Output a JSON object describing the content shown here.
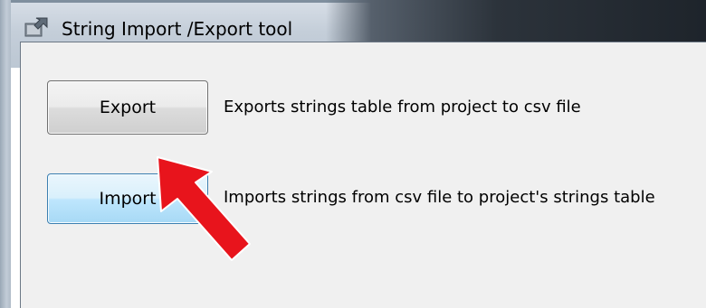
{
  "window": {
    "title": "String Import /Export tool",
    "icon": "app-window-icon"
  },
  "export": {
    "button_label": "Export",
    "description": "Exports strings table from project to csv file"
  },
  "import": {
    "button_label": "Import",
    "description": "Imports strings from csv file to project's strings table"
  },
  "annotation": {
    "arrow_icon": "red-pointer-arrow-icon",
    "arrow_color": "#e8141c",
    "points_to": "import-button"
  },
  "colors": {
    "import_button_hover": "#bee6fd",
    "export_button": "#e5e5e5",
    "client_background": "#f0f0f0"
  }
}
